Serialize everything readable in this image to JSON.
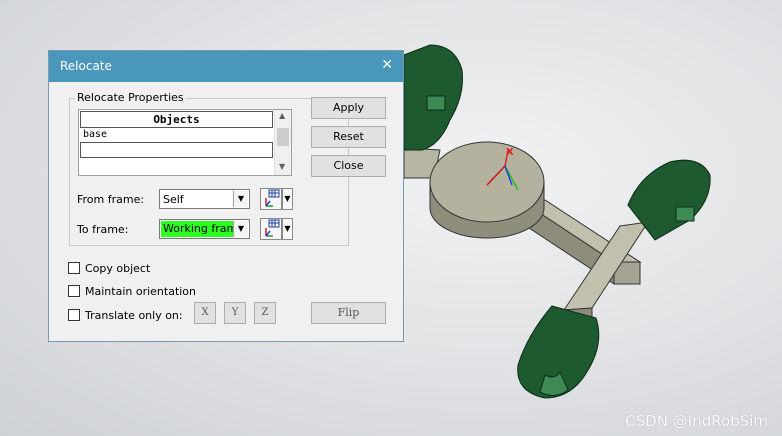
{
  "dialog": {
    "title": "Relocate",
    "close_glyph": "✕",
    "group_label": "Relocate Properties",
    "objects_header": "Objects",
    "objects": [
      "base",
      ""
    ],
    "from_frame_label": "From frame:",
    "from_frame_value": "Self",
    "to_frame_label": "To frame:",
    "to_frame_value": "Working frame",
    "to_frame_highlight": "#2bff1f",
    "buttons": {
      "apply": "Apply",
      "reset": "Reset",
      "close": "Close",
      "flip": "Flip"
    },
    "checkboxes": {
      "copy_object": {
        "label": "Copy object",
        "checked": false
      },
      "maintain_orientation": {
        "label": "Maintain orientation",
        "checked": false
      },
      "translate_only_on": {
        "label": "Translate only on:",
        "checked": false
      }
    },
    "axes": [
      "X",
      "Y",
      "Z"
    ],
    "dropdown_glyph": "▼",
    "scroll_up_glyph": "▲",
    "scroll_down_glyph": "▼"
  },
  "scene": {
    "model_color": "#1e5a30",
    "platform_color": "#b4b29e",
    "axis_x_label": "X",
    "axis_colors": {
      "x": "#e02020",
      "y": "#20c020",
      "z": "#2040e0"
    }
  },
  "watermark": "CSDN @IndRobSim",
  "icons": {
    "frame_picker": "frame-picker-icon",
    "dropdown": "chevron-down-icon",
    "close": "close-icon"
  }
}
